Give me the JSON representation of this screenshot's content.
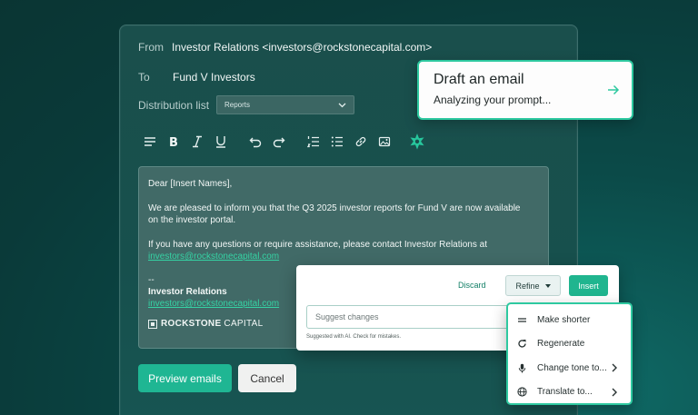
{
  "email": {
    "from_label": "From",
    "from_value": "Investor Relations  <investors@rockstonecapital.com>",
    "to_label": "To",
    "to_value": "Fund V Investors",
    "dist_label": "Distribution list",
    "dist_value": "Reports"
  },
  "toolbar": {
    "icons": [
      "align-icon",
      "bold-icon",
      "italic-icon",
      "underline-icon",
      "undo-icon",
      "redo-icon",
      "numbered-list-icon",
      "bullet-list-icon",
      "link-icon",
      "image-icon",
      "ai-sparkle-icon"
    ]
  },
  "body": {
    "greeting": "Dear [Insert Names],",
    "para1_line1": "We are pleased to inform you that the Q3 2025 investor reports for Fund V are now available",
    "para1_line2": "on the investor portal.",
    "para2": "If you have any questions or require assistance, please contact Investor Relations at",
    "para2_link": "investors@rockstonecapital.com",
    "sig_dash": "--",
    "sig_name": "Investor Relations",
    "sig_email": "investors@rockstonecapital.com",
    "logo_bold": "ROCKSTONE",
    "logo_rest": "CAPITAL"
  },
  "actions": {
    "preview": "Preview emails",
    "cancel": "Cancel"
  },
  "draft": {
    "title": "Draft an email",
    "subtitle": "Analyzing your prompt..."
  },
  "refine": {
    "discard": "Discard",
    "refine": "Refine",
    "insert": "Insert",
    "placeholder": "Suggest changes",
    "hint": "Suggested with AI. Check for mistakes."
  },
  "menu": {
    "items": [
      "Make shorter",
      "Regenerate",
      "Change tone to...",
      "Translate to..."
    ]
  },
  "colors": {
    "accent": "#2ec9a0",
    "link": "#35d3a4",
    "background": "#0b4a48"
  }
}
